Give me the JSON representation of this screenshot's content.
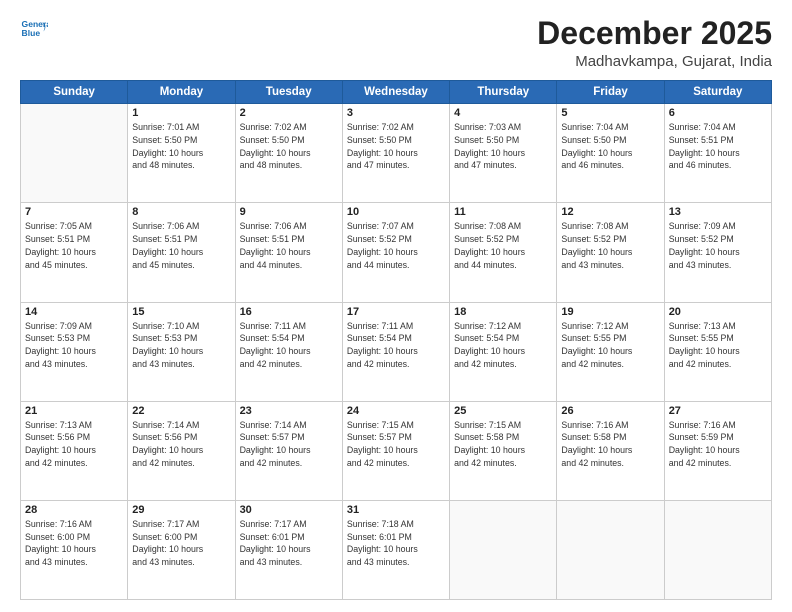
{
  "logo": {
    "line1": "General",
    "line2": "Blue"
  },
  "title": "December 2025",
  "location": "Madhavkampa, Gujarat, India",
  "headers": [
    "Sunday",
    "Monday",
    "Tuesday",
    "Wednesday",
    "Thursday",
    "Friday",
    "Saturday"
  ],
  "weeks": [
    [
      {
        "day": "",
        "info": ""
      },
      {
        "day": "1",
        "info": "Sunrise: 7:01 AM\nSunset: 5:50 PM\nDaylight: 10 hours\nand 48 minutes."
      },
      {
        "day": "2",
        "info": "Sunrise: 7:02 AM\nSunset: 5:50 PM\nDaylight: 10 hours\nand 48 minutes."
      },
      {
        "day": "3",
        "info": "Sunrise: 7:02 AM\nSunset: 5:50 PM\nDaylight: 10 hours\nand 47 minutes."
      },
      {
        "day": "4",
        "info": "Sunrise: 7:03 AM\nSunset: 5:50 PM\nDaylight: 10 hours\nand 47 minutes."
      },
      {
        "day": "5",
        "info": "Sunrise: 7:04 AM\nSunset: 5:50 PM\nDaylight: 10 hours\nand 46 minutes."
      },
      {
        "day": "6",
        "info": "Sunrise: 7:04 AM\nSunset: 5:51 PM\nDaylight: 10 hours\nand 46 minutes."
      }
    ],
    [
      {
        "day": "7",
        "info": "Sunrise: 7:05 AM\nSunset: 5:51 PM\nDaylight: 10 hours\nand 45 minutes."
      },
      {
        "day": "8",
        "info": "Sunrise: 7:06 AM\nSunset: 5:51 PM\nDaylight: 10 hours\nand 45 minutes."
      },
      {
        "day": "9",
        "info": "Sunrise: 7:06 AM\nSunset: 5:51 PM\nDaylight: 10 hours\nand 44 minutes."
      },
      {
        "day": "10",
        "info": "Sunrise: 7:07 AM\nSunset: 5:52 PM\nDaylight: 10 hours\nand 44 minutes."
      },
      {
        "day": "11",
        "info": "Sunrise: 7:08 AM\nSunset: 5:52 PM\nDaylight: 10 hours\nand 44 minutes."
      },
      {
        "day": "12",
        "info": "Sunrise: 7:08 AM\nSunset: 5:52 PM\nDaylight: 10 hours\nand 43 minutes."
      },
      {
        "day": "13",
        "info": "Sunrise: 7:09 AM\nSunset: 5:52 PM\nDaylight: 10 hours\nand 43 minutes."
      }
    ],
    [
      {
        "day": "14",
        "info": "Sunrise: 7:09 AM\nSunset: 5:53 PM\nDaylight: 10 hours\nand 43 minutes."
      },
      {
        "day": "15",
        "info": "Sunrise: 7:10 AM\nSunset: 5:53 PM\nDaylight: 10 hours\nand 43 minutes."
      },
      {
        "day": "16",
        "info": "Sunrise: 7:11 AM\nSunset: 5:54 PM\nDaylight: 10 hours\nand 42 minutes."
      },
      {
        "day": "17",
        "info": "Sunrise: 7:11 AM\nSunset: 5:54 PM\nDaylight: 10 hours\nand 42 minutes."
      },
      {
        "day": "18",
        "info": "Sunrise: 7:12 AM\nSunset: 5:54 PM\nDaylight: 10 hours\nand 42 minutes."
      },
      {
        "day": "19",
        "info": "Sunrise: 7:12 AM\nSunset: 5:55 PM\nDaylight: 10 hours\nand 42 minutes."
      },
      {
        "day": "20",
        "info": "Sunrise: 7:13 AM\nSunset: 5:55 PM\nDaylight: 10 hours\nand 42 minutes."
      }
    ],
    [
      {
        "day": "21",
        "info": "Sunrise: 7:13 AM\nSunset: 5:56 PM\nDaylight: 10 hours\nand 42 minutes."
      },
      {
        "day": "22",
        "info": "Sunrise: 7:14 AM\nSunset: 5:56 PM\nDaylight: 10 hours\nand 42 minutes."
      },
      {
        "day": "23",
        "info": "Sunrise: 7:14 AM\nSunset: 5:57 PM\nDaylight: 10 hours\nand 42 minutes."
      },
      {
        "day": "24",
        "info": "Sunrise: 7:15 AM\nSunset: 5:57 PM\nDaylight: 10 hours\nand 42 minutes."
      },
      {
        "day": "25",
        "info": "Sunrise: 7:15 AM\nSunset: 5:58 PM\nDaylight: 10 hours\nand 42 minutes."
      },
      {
        "day": "26",
        "info": "Sunrise: 7:16 AM\nSunset: 5:58 PM\nDaylight: 10 hours\nand 42 minutes."
      },
      {
        "day": "27",
        "info": "Sunrise: 7:16 AM\nSunset: 5:59 PM\nDaylight: 10 hours\nand 42 minutes."
      }
    ],
    [
      {
        "day": "28",
        "info": "Sunrise: 7:16 AM\nSunset: 6:00 PM\nDaylight: 10 hours\nand 43 minutes."
      },
      {
        "day": "29",
        "info": "Sunrise: 7:17 AM\nSunset: 6:00 PM\nDaylight: 10 hours\nand 43 minutes."
      },
      {
        "day": "30",
        "info": "Sunrise: 7:17 AM\nSunset: 6:01 PM\nDaylight: 10 hours\nand 43 minutes."
      },
      {
        "day": "31",
        "info": "Sunrise: 7:18 AM\nSunset: 6:01 PM\nDaylight: 10 hours\nand 43 minutes."
      },
      {
        "day": "",
        "info": ""
      },
      {
        "day": "",
        "info": ""
      },
      {
        "day": "",
        "info": ""
      }
    ]
  ]
}
